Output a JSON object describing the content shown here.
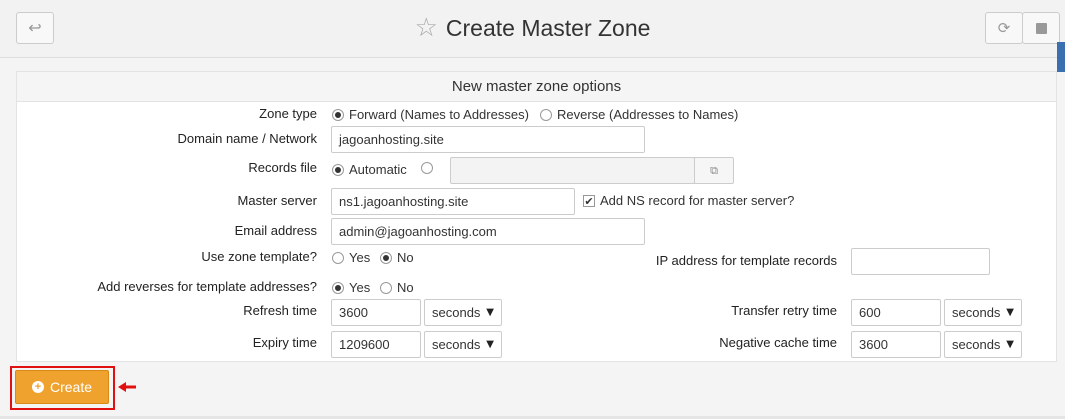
{
  "header": {
    "title": "Create Master Zone",
    "back_icon": "back-arrow-icon",
    "title_icon": "star-icon",
    "refresh_icon": "refresh-icon",
    "stop_icon": "stop-icon"
  },
  "panel": {
    "heading": "New master zone options"
  },
  "form": {
    "zone_type": {
      "label": "Zone type",
      "options": [
        "Forward (Names to Addresses)",
        "Reverse (Addresses to Names)"
      ],
      "selected": "Forward (Names to Addresses)"
    },
    "domain": {
      "label": "Domain name / Network",
      "value": "jagoanhosting.site"
    },
    "records_file": {
      "label": "Records file",
      "options": [
        "Automatic",
        ""
      ],
      "selected": "Automatic",
      "value": "",
      "button_icon": "file-chooser-icon"
    },
    "master_server": {
      "label": "Master server",
      "value": "ns1.jagoanhosting.site",
      "add_ns_label": "Add NS record for master server?",
      "add_ns_checked": true
    },
    "email": {
      "label": "Email address",
      "value": "admin@jagoanhosting.com"
    },
    "use_template": {
      "label": "Use zone template?",
      "options": [
        "Yes",
        "No"
      ],
      "selected": "No"
    },
    "template_ip": {
      "label": "IP address for template records",
      "value": ""
    },
    "add_reverses": {
      "label": "Add reverses for template addresses?",
      "options": [
        "Yes",
        "No"
      ],
      "selected": "Yes"
    },
    "refresh": {
      "label": "Refresh time",
      "value": "3600",
      "unit": "seconds"
    },
    "transfer_retry": {
      "label": "Transfer retry time",
      "value": "600",
      "unit": "seconds"
    },
    "expiry": {
      "label": "Expiry time",
      "value": "1209600",
      "unit": "seconds"
    },
    "negative_cache": {
      "label": "Negative cache time",
      "value": "3600",
      "unit": "seconds"
    }
  },
  "actions": {
    "create_label": "Create",
    "create_icon": "plus-circle-icon",
    "pointer_icon": "red-arrow-icon"
  },
  "colors": {
    "create_button": "#f0a22e",
    "highlight_frame": "#e01010",
    "scroll_accent": "#3a6fb0"
  }
}
